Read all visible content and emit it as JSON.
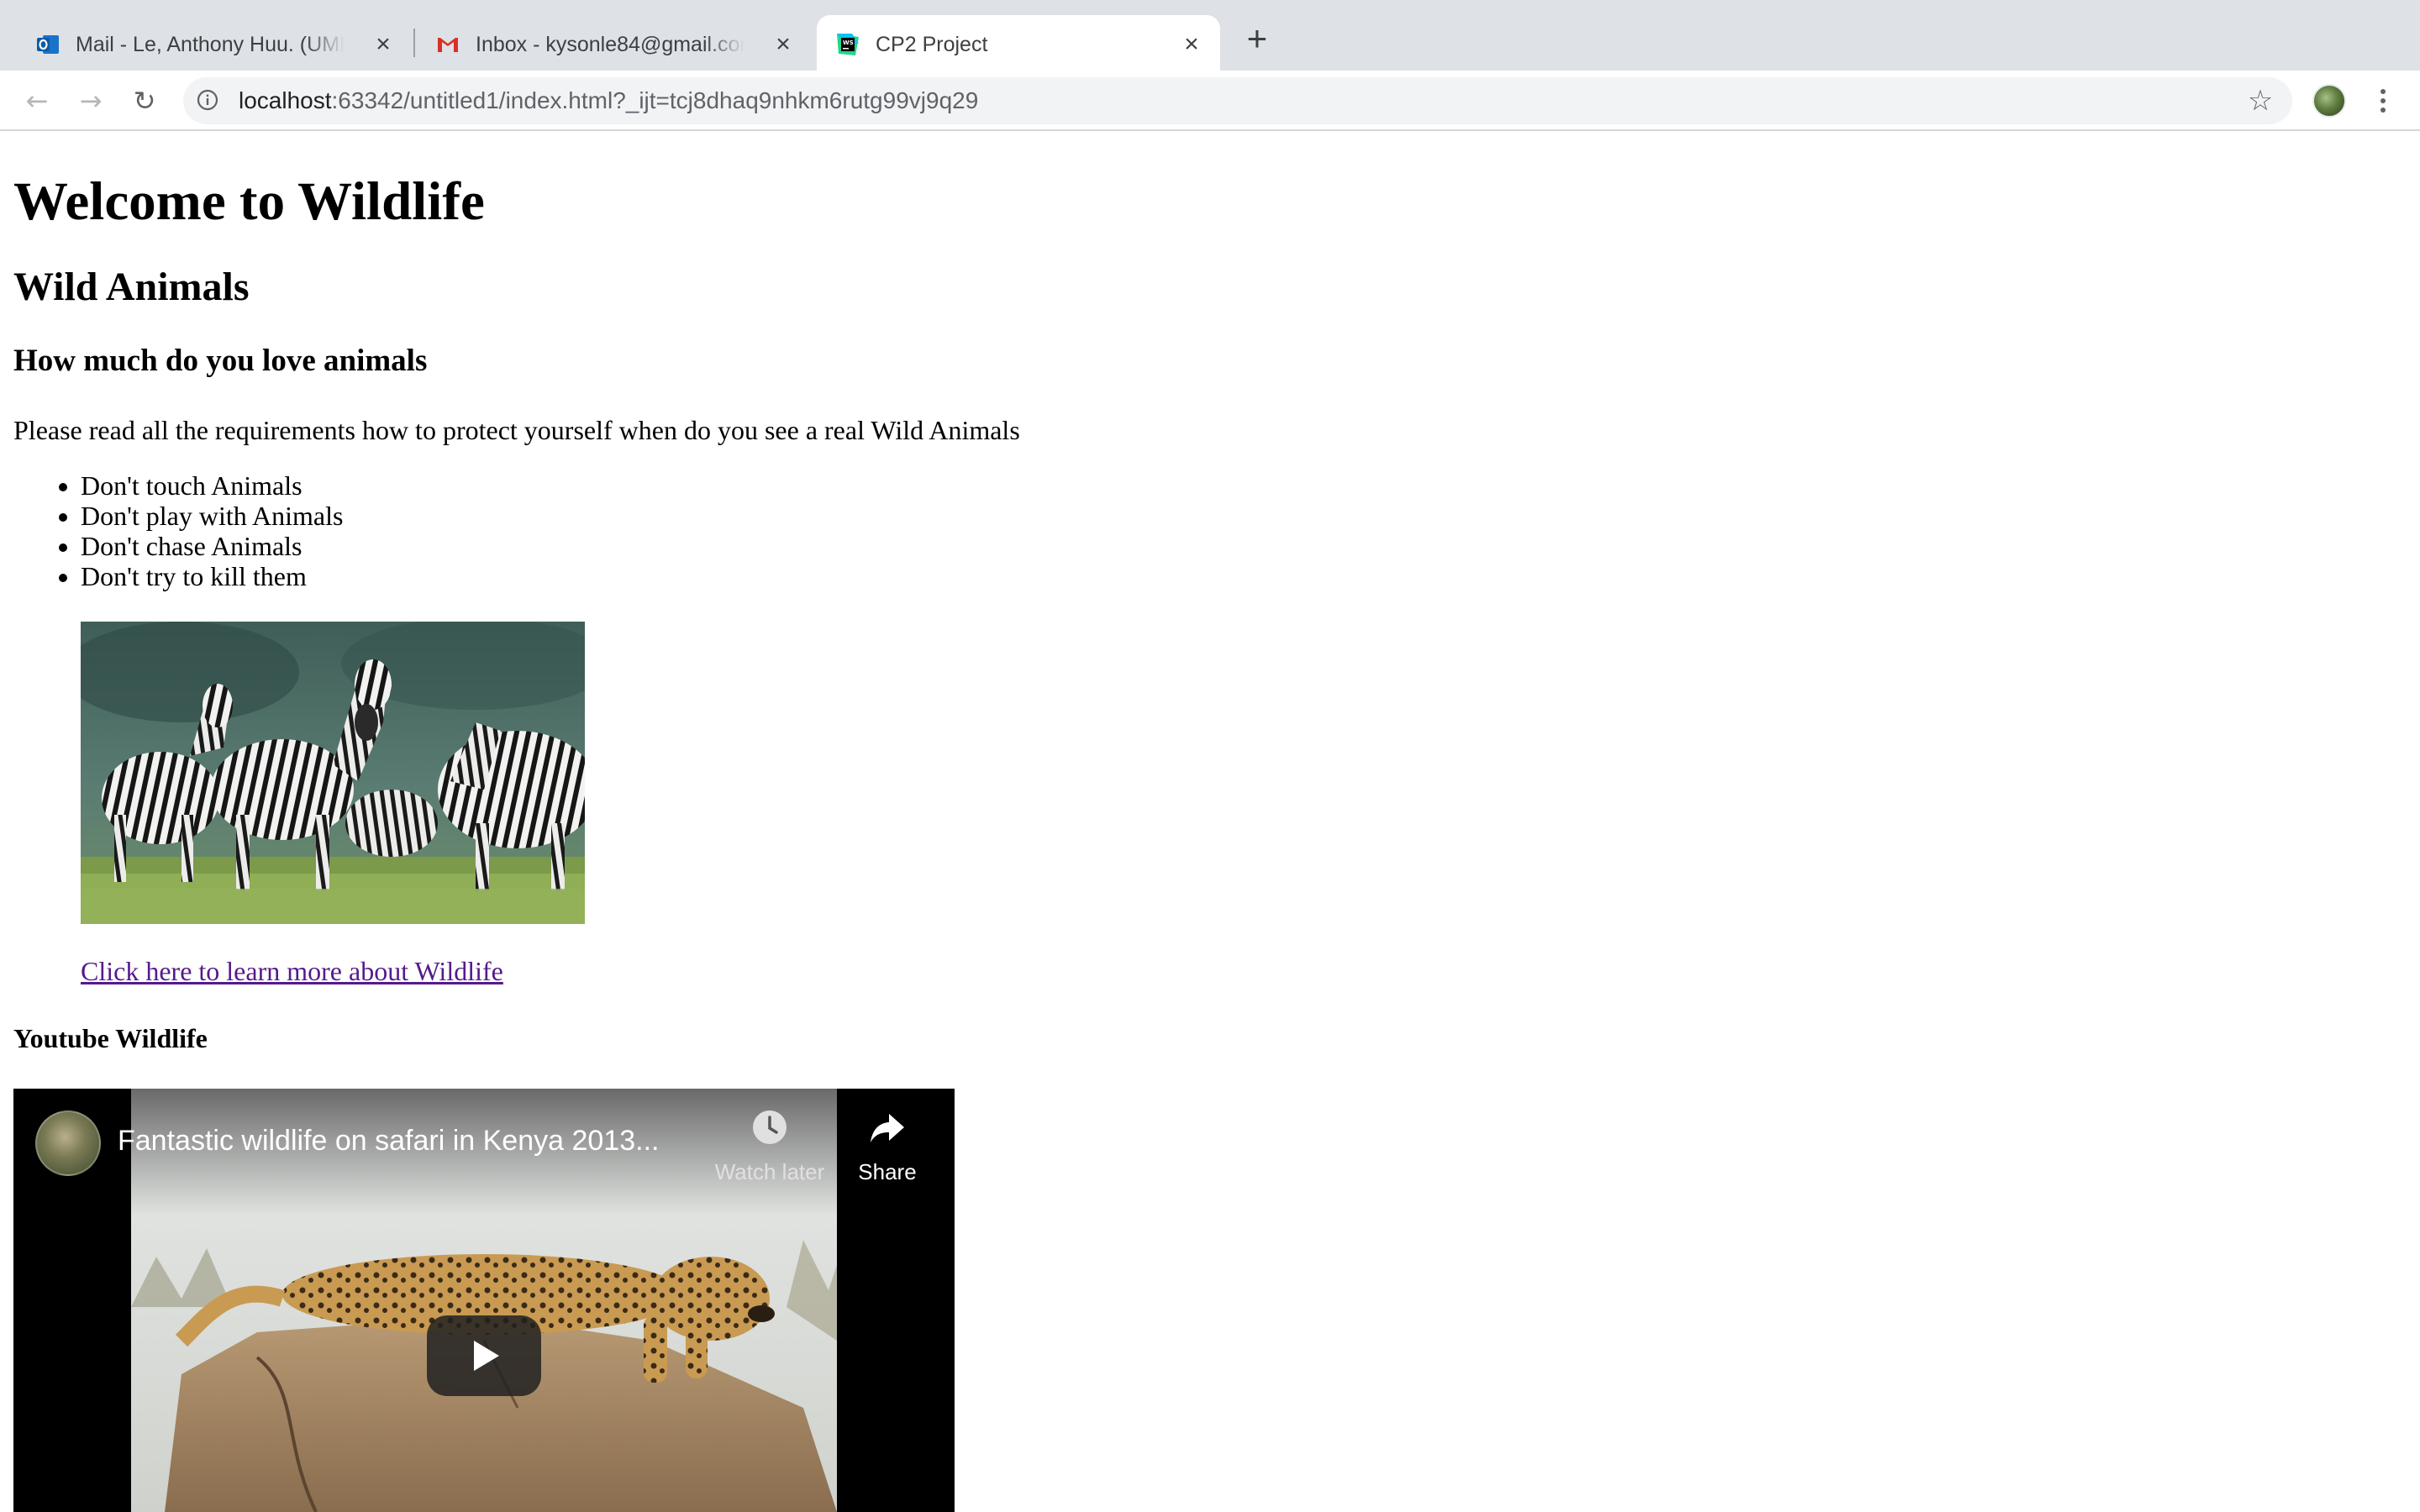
{
  "browser": {
    "tabs": [
      {
        "title": "Mail - Le, Anthony Huu. (UMKC",
        "icon": "outlook-icon",
        "active": false
      },
      {
        "title": "Inbox - kysonle84@gmail.com",
        "icon": "gmail-icon",
        "active": false
      },
      {
        "title": "CP2 Project",
        "icon": "webstorm-icon",
        "active": true
      }
    ],
    "new_tab_label": "+",
    "address": {
      "host": "localhost",
      "rest": ":63342/untitled1/index.html?_ijt=tcj8dhaq9nhkm6rutg99vj9q29"
    }
  },
  "page": {
    "h1": "Welcome to Wildlife",
    "h2": "Wild Animals",
    "h3": "How much do you love animals",
    "intro": "Please read all the requirements how to protect yourself when do you see a real Wild Animals",
    "rules": [
      "Don't touch Animals",
      "Don't play with Animals",
      "Don't chase Animals",
      "Don't try to kill them"
    ],
    "link_text": "Click here to learn more about Wildlife",
    "youtube_heading": "Youtube Wildlife",
    "video": {
      "title": "Fantastic wildlife on safari in Kenya 2013...",
      "watch_later": "Watch later",
      "share": "Share"
    }
  },
  "colors": {
    "tabstrip_bg": "#dee1e6",
    "visited_link": "#551a8b",
    "video_bg": "#000000"
  }
}
